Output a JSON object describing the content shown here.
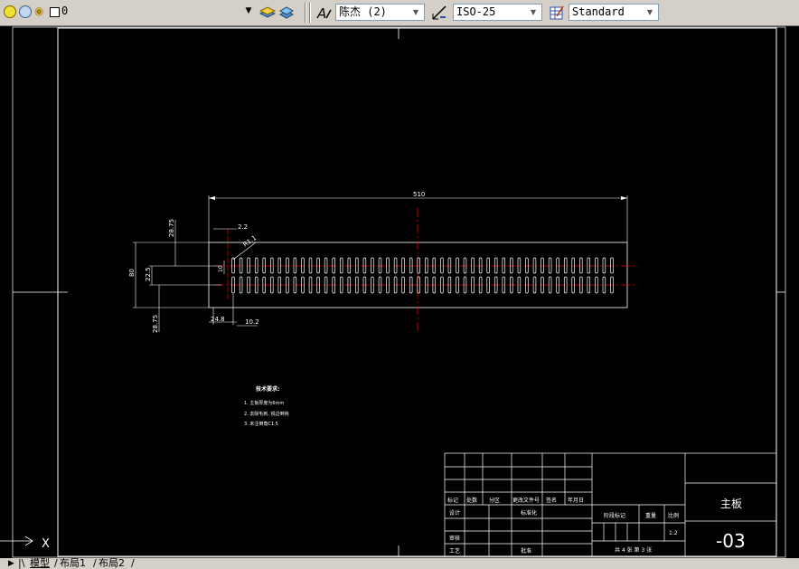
{
  "layer": {
    "current": "0"
  },
  "text_style": {
    "value": "陈杰 (2)"
  },
  "dim_style": {
    "value": "ISO-25"
  },
  "table_style": {
    "value": "Standard"
  },
  "drawing": {
    "overall_width": "510",
    "height_total": "80",
    "top_offset": "28.75",
    "bottom_offset": "28.75",
    "slot_spacing_label": "2.2",
    "slot_length_label": "22.5",
    "slot_radius": "R1.1",
    "slot_pitch": "10.2",
    "left_margin": "24.8",
    "slot_height_small": "10",
    "slot_count_per_row": 50
  },
  "notes": {
    "title": "技术要求:",
    "items": [
      "1. 主板厚度为6mm",
      "2. 去除毛刺, 锐边倒钝",
      "3. 未注倒角C1.5"
    ]
  },
  "title_block": {
    "part_name": "主板",
    "drawing_no": "-03",
    "headers": [
      "标记",
      "处数",
      "分区",
      "更改文件号",
      "签名",
      "年月日"
    ],
    "row_design": "设计",
    "row_standard": "标准化",
    "row_check": "审核",
    "row_process": "工艺",
    "row_approve": "批准",
    "stage_mark": "阶段标记",
    "weight": "重量",
    "scale": "比例",
    "scale_value": "1:2",
    "sheet_info": "共 4 张  第 3 张"
  },
  "layout_tabs": [
    "模型",
    "布局1",
    "布局2"
  ],
  "ucs_label": "X"
}
